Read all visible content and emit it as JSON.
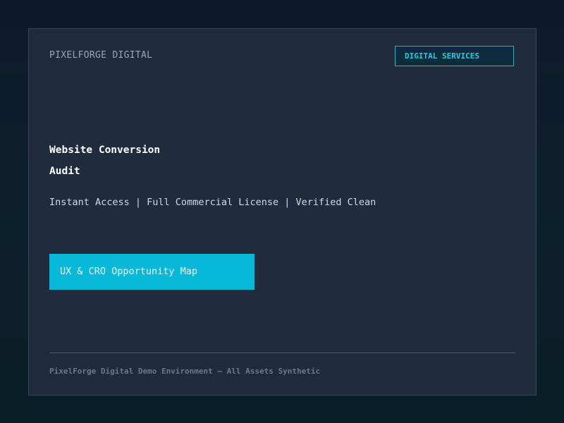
{
  "header": {
    "brand": "PIXELFORGE DIGITAL",
    "badge_label": "DIGITAL SERVICES"
  },
  "main": {
    "title_line1": "Website Conversion",
    "title_line2": "Audit",
    "features": "Instant Access | Full Commercial License | Verified Clean",
    "cta_label": "UX & CRO Opportunity Map"
  },
  "footer": {
    "text": "PixelForge Digital Demo Environment – All Assets Synthetic"
  },
  "colors": {
    "accent": "#08b8d8",
    "card_background": "#202b3d",
    "page_background": "#0e1a2c"
  }
}
